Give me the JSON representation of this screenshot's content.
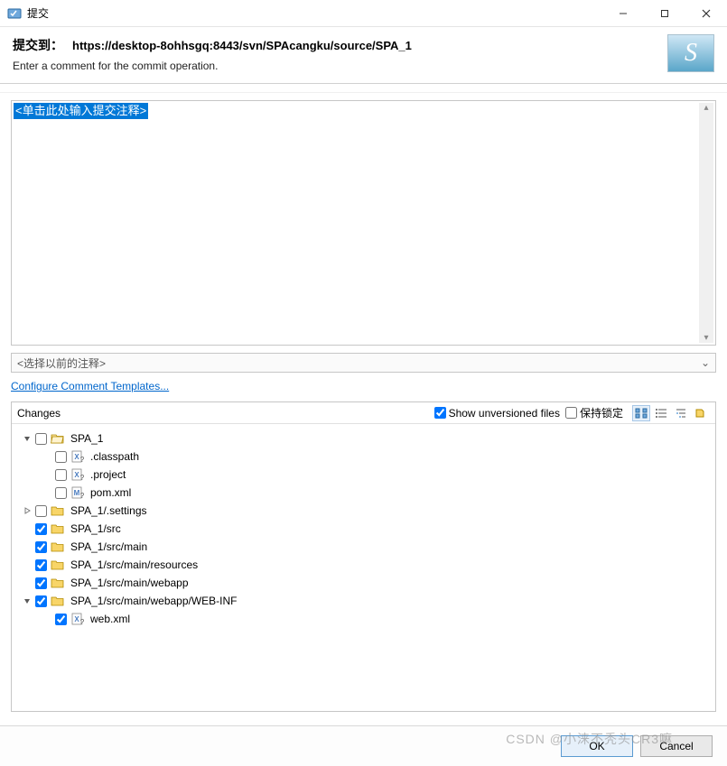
{
  "window": {
    "title": "提交",
    "icon": "svn-commit-icon"
  },
  "header": {
    "label": "提交到：",
    "url": "https://desktop-8ohhsgq:8443/svn/SPAcangku/source/SPA_1",
    "subtitle": "Enter a comment for the commit operation."
  },
  "comment": {
    "placeholder": "<单击此处输入提交注释>"
  },
  "prev_comments_placeholder": "<选择以前的注释>",
  "link": {
    "configure_templates": "Configure Comment Templates..."
  },
  "changes": {
    "title": "Changes",
    "show_unversioned_label": "Show unversioned files",
    "show_unversioned_checked": true,
    "keep_locks_label": "保持锁定",
    "keep_locks_checked": false
  },
  "tree": [
    {
      "depth": 0,
      "expander": "open",
      "checked": false,
      "icon": "folder-open",
      "label": "SPA_1"
    },
    {
      "depth": 1,
      "expander": "none",
      "checked": false,
      "icon": "file-x-unversioned",
      "label": ".classpath"
    },
    {
      "depth": 1,
      "expander": "none",
      "checked": false,
      "icon": "file-x-unversioned",
      "label": ".project"
    },
    {
      "depth": 1,
      "expander": "none",
      "checked": false,
      "icon": "file-m-unversioned",
      "label": "pom.xml"
    },
    {
      "depth": 0,
      "expander": "closed",
      "checked": false,
      "icon": "folder",
      "label": "SPA_1/.settings"
    },
    {
      "depth": 0,
      "expander": "none",
      "checked": true,
      "icon": "folder",
      "label": "SPA_1/src"
    },
    {
      "depth": 0,
      "expander": "none",
      "checked": true,
      "icon": "folder",
      "label": "SPA_1/src/main"
    },
    {
      "depth": 0,
      "expander": "none",
      "checked": true,
      "icon": "folder",
      "label": "SPA_1/src/main/resources"
    },
    {
      "depth": 0,
      "expander": "none",
      "checked": true,
      "icon": "folder",
      "label": "SPA_1/src/main/webapp"
    },
    {
      "depth": 0,
      "expander": "open",
      "checked": true,
      "icon": "folder",
      "label": "SPA_1/src/main/webapp/WEB-INF"
    },
    {
      "depth": 1,
      "expander": "none",
      "checked": true,
      "icon": "file-x-unversioned",
      "label": "web.xml"
    }
  ],
  "footer": {
    "ok": "OK",
    "cancel": "Cancel"
  },
  "watermark": "CSDN @小涞不秃头CR3嘛"
}
